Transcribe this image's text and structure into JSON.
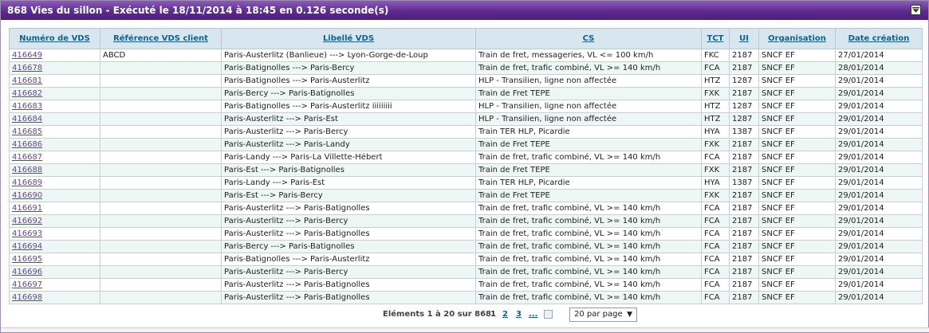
{
  "panel": {
    "title": "868 Vies du sillon - Exécuté le 18/11/2014 à 18:45 en 0.126 seconde(s)"
  },
  "table": {
    "headers": [
      "Numéro de VDS",
      "Référence VDS client",
      "Libellé VDS",
      "CS",
      "TCT",
      "UI",
      "Organisation",
      "Date création"
    ],
    "rows": [
      [
        "416649",
        "ABCD",
        "Paris-Austerlitz (Banlieue) ---> Lyon-Gorge-de-Loup",
        "Train de fret, messageries, VL <= 100 km/h",
        "FKC",
        "2187",
        "SNCF EF",
        "27/01/2014"
      ],
      [
        "416678",
        "",
        "Paris-Batignolles ---> Paris-Bercy",
        "Train de fret, trafic combiné, VL >= 140 km/h",
        "FCA",
        "2187",
        "SNCF EF",
        "28/01/2014"
      ],
      [
        "416681",
        "",
        "Paris-Batignolles ---> Paris-Austerlitz",
        "HLP - Transilien, ligne non affectée",
        "HTZ",
        "1287",
        "SNCF EF",
        "29/01/2014"
      ],
      [
        "416682",
        "",
        "Paris-Bercy ---> Paris-Batignolles",
        "Train de Fret TEPE",
        "FXK",
        "2187",
        "SNCF EF",
        "29/01/2014"
      ],
      [
        "416683",
        "",
        "Paris-Batignolles ---> Paris-Austerlitz iiiiiiiii",
        "HLP - Transilien, ligne non affectée",
        "HTZ",
        "1287",
        "SNCF EF",
        "29/01/2014"
      ],
      [
        "416684",
        "",
        "Paris-Austerlitz ---> Paris-Est",
        "HLP - Transilien, ligne non affectée",
        "HTZ",
        "1287",
        "SNCF EF",
        "29/01/2014"
      ],
      [
        "416685",
        "",
        "Paris-Austerlitz ---> Paris-Bercy",
        "Train TER HLP, Picardie",
        "HYA",
        "1387",
        "SNCF EF",
        "29/01/2014"
      ],
      [
        "416686",
        "",
        "Paris-Austerlitz ---> Paris-Landy",
        "Train de Fret TEPE",
        "FXK",
        "2187",
        "SNCF EF",
        "29/01/2014"
      ],
      [
        "416687",
        "",
        "Paris-Landy ---> Paris-La Villette-Hébert",
        "Train de fret, trafic combiné, VL >= 140 km/h",
        "FCA",
        "2187",
        "SNCF EF",
        "29/01/2014"
      ],
      [
        "416688",
        "",
        "Paris-Est ---> Paris-Batignolles",
        "Train de Fret TEPE",
        "FXK",
        "2187",
        "SNCF EF",
        "29/01/2014"
      ],
      [
        "416689",
        "",
        "Paris-Landy ---> Paris-Est",
        "Train TER HLP, Picardie",
        "HYA",
        "1387",
        "SNCF EF",
        "29/01/2014"
      ],
      [
        "416690",
        "",
        "Paris-Est ---> Paris-Bercy",
        "Train de Fret TEPE",
        "FXK",
        "2187",
        "SNCF EF",
        "29/01/2014"
      ],
      [
        "416691",
        "",
        "Paris-Austerlitz ---> Paris-Batignolles",
        "Train de fret, trafic combiné, VL >= 140 km/h",
        "FCA",
        "2187",
        "SNCF EF",
        "29/01/2014"
      ],
      [
        "416692",
        "",
        "Paris-Austerlitz ---> Paris-Bercy",
        "Train de fret, trafic combiné, VL >= 140 km/h",
        "FCA",
        "2187",
        "SNCF EF",
        "29/01/2014"
      ],
      [
        "416693",
        "",
        "Paris-Austerlitz ---> Paris-Batignolles",
        "Train de fret, trafic combiné, VL >= 140 km/h",
        "FCA",
        "2187",
        "SNCF EF",
        "29/01/2014"
      ],
      [
        "416694",
        "",
        "Paris-Bercy ---> Paris-Batignolles",
        "Train de fret, trafic combiné, VL >= 140 km/h",
        "FCA",
        "2187",
        "SNCF EF",
        "29/01/2014"
      ],
      [
        "416695",
        "",
        "Paris-Batignolles ---> Paris-Austerlitz",
        "Train de fret, trafic combiné, VL >= 140 km/h",
        "FCA",
        "2187",
        "SNCF EF",
        "29/01/2014"
      ],
      [
        "416696",
        "",
        "Paris-Austerlitz ---> Paris-Bercy",
        "Train de fret, trafic combiné, VL >= 140 km/h",
        "FCA",
        "2187",
        "SNCF EF",
        "29/01/2014"
      ],
      [
        "416697",
        "",
        "Paris-Austerlitz ---> Paris-Batignolles",
        "Train de fret, trafic combiné, VL >= 140 km/h",
        "FCA",
        "2187",
        "SNCF EF",
        "29/01/2014"
      ],
      [
        "416698",
        "",
        "Paris-Austerlitz ---> Paris-Batignolles",
        "Train de fret, trafic combiné, VL >= 140 km/h",
        "FCA",
        "2187",
        "SNCF EF",
        "29/01/2014"
      ]
    ]
  },
  "pager": {
    "count_text": "Eléments 1 à 20 sur 868",
    "pages": [
      "1",
      "2",
      "3",
      "..."
    ],
    "current_page": "1",
    "page_size_selected": "20 par page",
    "next_icon": "next-page-icon"
  },
  "colors": {
    "title_bar": "#5d2b8e",
    "header_bg": "#d7e6ef",
    "link": "#1a5d8c",
    "id_link": "#6b3fa0",
    "row_alt": "#eef6f6"
  }
}
